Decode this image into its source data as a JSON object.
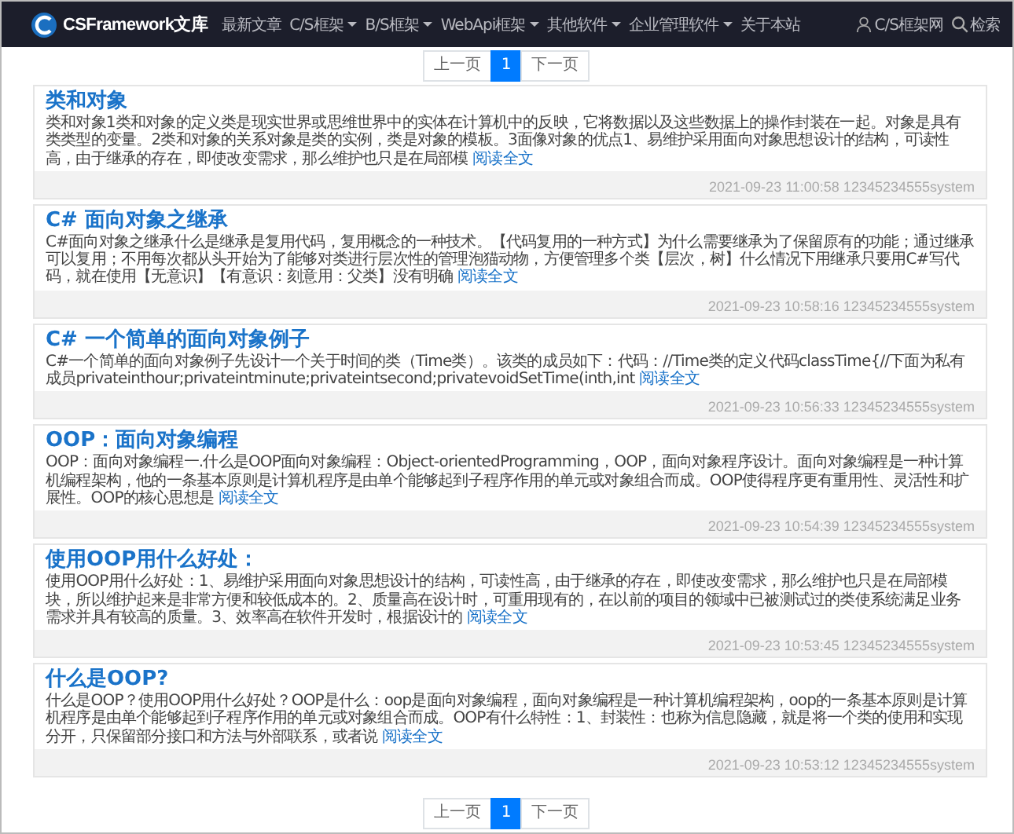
{
  "navbar": {
    "brand": "CSFramework文库",
    "items": [
      {
        "label": "最新文章",
        "has_menu": false
      },
      {
        "label": "C/S框架",
        "has_menu": true
      },
      {
        "label": "B/S框架",
        "has_menu": true
      },
      {
        "label": "WebApi框架",
        "has_menu": true
      },
      {
        "label": "其他软件",
        "has_menu": true
      },
      {
        "label": "企业管理软件",
        "has_menu": true
      },
      {
        "label": "关于本站",
        "has_menu": false
      }
    ],
    "account": "C/S框架网",
    "search": "检索"
  },
  "pagination_top": [
    {
      "label": "上一页",
      "selected": false
    },
    {
      "label": "1",
      "selected": true
    },
    {
      "label": "下一页",
      "selected": false
    }
  ],
  "articles": [
    {
      "title": "类和对象",
      "summary": "类和对象1类和对象的定义类是现实世界或思维世界中的实体在计算机中的反映，它将数据以及这些数据上的操作封装在一起。对象是具有类类型的变量。2类和对象的关系对象是类的实例，类是对象的模板。3面像对象的优点1、易维护采用面向对象思想设计的结构，可读性高，由于继承的存在，即使改变需求，那么维护也只是在局部模",
      "link": "阅读全文",
      "meta": "2021-09-23 11:00:58 12345234555system"
    },
    {
      "title": "C# 面向对象之继承",
      "summary": "C#面向对象之继承什么是继承是复用代码，复用概念的一种技术。【代码复用的一种方式】为什么需要继承为了保留原有的功能；通过继承可以复用；不用每次都从头开始为了能够对类进行层次性的管理泡猫动物，方便管理多个类【层次，树】什么情况下用继承只要用C#写代码，就在使用【无意识】【有意识：刻意用：父类】没有明确",
      "link": "阅读全文",
      "meta": "2021-09-23 10:58:16 12345234555system"
    },
    {
      "title": "C# 一个简单的面向对象例子",
      "summary": "C#一个简单的面向对象例子先设计一个关于时间的类（Time类）。该类的成员如下：代码：//Time类的定义代码classTime{//下面为私有成员privateinthour;privateintminute;privateintsecond;privatevoidSetTime(inth,int",
      "link": "阅读全文",
      "meta": "2021-09-23 10:56:33 12345234555system"
    },
    {
      "title": "OOP：面向对象编程",
      "summary": "OOP：面向对象编程一.什么是OOP面向对象编程：Object-orientedProgramming，OOP，面向对象程序设计。面向对象编程是一种计算机编程架构，他的一条基本原则是计算机程序是由单个能够起到子程序作用的单元或对象组合而成。OOP使得程序更有重用性、灵活性和扩展性。OOP的核心思想是",
      "link": "阅读全文",
      "meta": "2021-09-23 10:54:39 12345234555system"
    },
    {
      "title": "使用OOP用什么好处：",
      "summary": "使用OOP用什么好处：1、易维护采用面向对象思想设计的结构，可读性高，由于继承的存在，即使改变需求，那么维护也只是在局部模块，所以维护起来是非常方便和较低成本的。2、质量高在设计时，可重用现有的，在以前的项目的领域中已被测试过的类使系统满足业务需求并具有较高的质量。3、效率高在软件开发时，根据设计的",
      "link": "阅读全文",
      "meta": "2021-09-23 10:53:45 12345234555system"
    },
    {
      "title": "什么是OOP?",
      "summary": "什么是OOP？使用OOP用什么好处？OOP是什么：oop是面向对象编程，面向对象编程是一种计算机编程架构，oop的一条基本原则是计算机程序是由单个能够起到子程序作用的单元或对象组合而成。OOP有什么特性：1、封装性：也称为信息隐藏，就是将一个类的使用和实现分开，只保留部分接口和方法与外部联系，或者说",
      "link": "阅读全文",
      "meta": "2021-09-23 10:53:12 12345234555system"
    }
  ],
  "pagination_bottom": [
    {
      "label": "上一页",
      "selected": false
    },
    {
      "label": "1",
      "selected": true
    },
    {
      "label": "下一页",
      "selected": false
    }
  ]
}
